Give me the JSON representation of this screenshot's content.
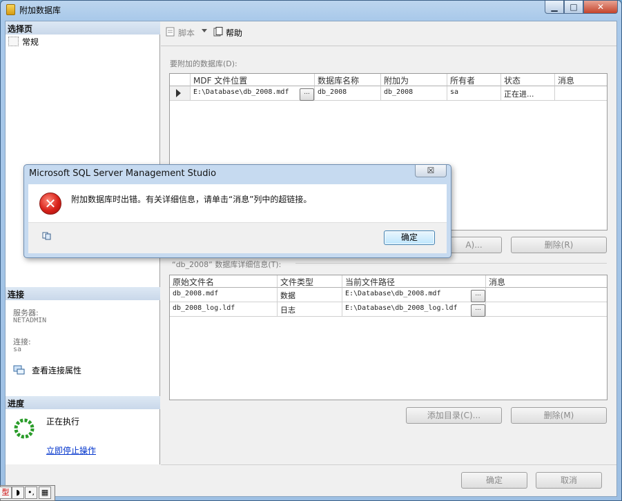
{
  "window": {
    "title": "附加数据库"
  },
  "caption_buttons": {
    "minimize": "▁",
    "maximize": "□",
    "close": "✕"
  },
  "left": {
    "select_page_header": "选择页",
    "pages": [
      {
        "label": "常规"
      }
    ],
    "connection_header": "连接",
    "server_label": "服务器:",
    "server_value": "NETADMIN",
    "connection_label": "连接:",
    "connection_value": "sa",
    "view_connection_props": "查看连接属性",
    "progress_header": "进度",
    "progress_status": "正在执行",
    "stop_link": "立即停止操作"
  },
  "toolbar": {
    "script_label": "脚本",
    "help_label": "帮助"
  },
  "databases_section": {
    "label": "要附加的数据库(D):",
    "columns": [
      "MDF 文件位置",
      "数据库名称",
      "附加为",
      "所有者",
      "状态",
      "消息"
    ],
    "rows": [
      {
        "mdf": "E:\\Database\\db_2008.mdf",
        "dbname": "db_2008",
        "attach_as": "db_2008",
        "owner": "sa",
        "status": "正在进...",
        "message": ""
      }
    ],
    "add_button_partial": "A)...",
    "remove_button": "删除(R)"
  },
  "details_section": {
    "label": "“db_2008” 数据库详细信息(T):",
    "columns": [
      "原始文件名",
      "文件类型",
      "当前文件路径",
      "消息"
    ],
    "rows": [
      {
        "original": "db_2008.mdf",
        "type": "数据",
        "path": "E:\\Database\\db_2008.mdf",
        "message": ""
      },
      {
        "original": "db_2008_log.ldf",
        "type": "日志",
        "path": "E:\\Database\\db_2008_log.ldf",
        "message": ""
      }
    ],
    "add_catalog_button": "添加目录(C)...",
    "remove_button": "删除(M)"
  },
  "footer": {
    "ok": "确定",
    "cancel": "取消"
  },
  "dialog": {
    "title": "Microsoft SQL Server Management Studio",
    "message": "附加数据库时出错。有关详细信息，请单击“消息”列中的超链接。",
    "ok": "确定",
    "close": "☒"
  },
  "ellipsis": "...",
  "status_strip": {
    "items": [
      "型",
      "◗",
      "•,",
      "▦"
    ]
  },
  "colors": {
    "link": "#0033cc",
    "error": "#d8221a",
    "header_bg": "#c9d8ea"
  }
}
